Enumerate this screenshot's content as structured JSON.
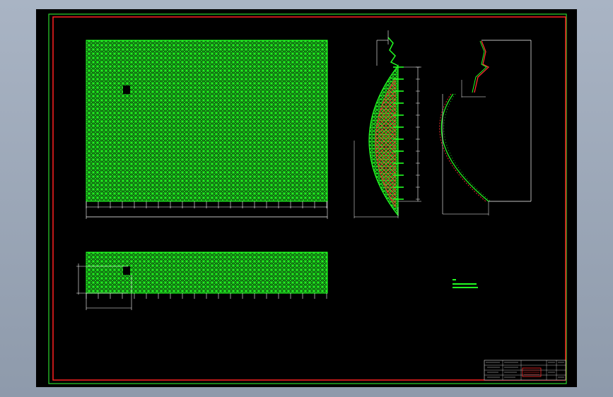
{
  "viewer": {
    "background_top": "#a9b4c4",
    "background_bottom": "#8e9aab"
  },
  "drawing": {
    "sheet_color": "#000000",
    "outer_frame_color": "#2bd62b",
    "inner_frame_color": "#ff2020",
    "mesh_color": "#22ff22",
    "member_color": "#ff3030",
    "line_color": "#ffffff",
    "dimension_labels": {
      "plan_width": "",
      "section_span": "",
      "elevation_width": "",
      "elevation_height": "",
      "strip_width": "",
      "strip_height": ""
    },
    "legend": {
      "title": "",
      "lines": [
        "",
        ""
      ]
    },
    "title_block": {
      "title": "",
      "stamp": "",
      "cells": [
        "",
        "",
        "",
        "",
        "",
        ""
      ]
    }
  }
}
